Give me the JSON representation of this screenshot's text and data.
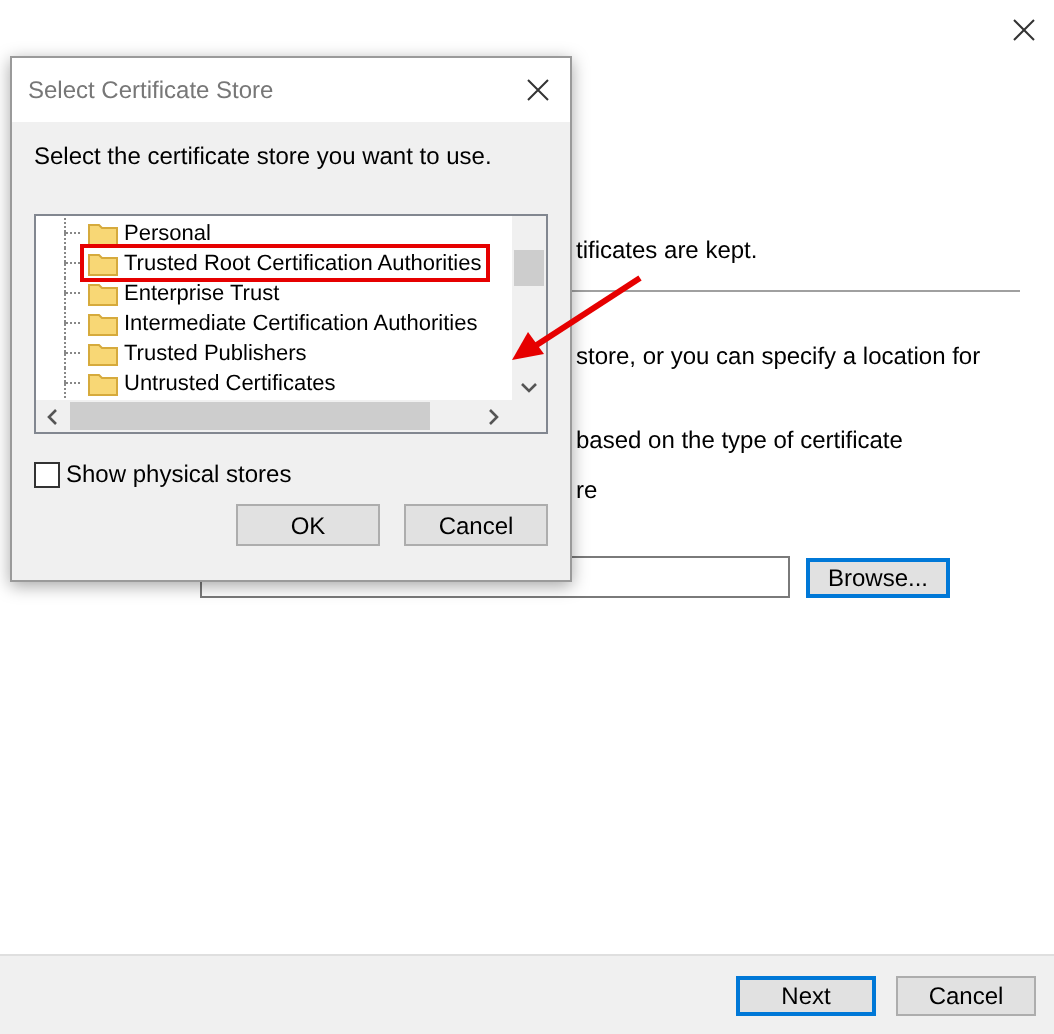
{
  "wizard": {
    "texts": [
      "tificates are kept.",
      "store, or you can specify a location for",
      "based on the type of certificate",
      "re"
    ],
    "browse_button": "Browse...",
    "buttons": [
      {
        "label": "Next",
        "default": true
      },
      {
        "label": "Cancel",
        "default": false
      }
    ]
  },
  "dialog": {
    "title": "Select Certificate Store",
    "prompt": "Select the certificate store you want to use.",
    "stores": [
      {
        "label": "Personal",
        "selected": false
      },
      {
        "label": "Trusted Root Certification Authorities",
        "selected": true
      },
      {
        "label": "Enterprise Trust",
        "selected": false
      },
      {
        "label": "Intermediate Certification Authorities",
        "selected": false
      },
      {
        "label": "Trusted Publishers",
        "selected": false
      },
      {
        "label": "Untrusted Certificates",
        "selected": false
      }
    ],
    "show_physical": {
      "label": "Show physical stores",
      "checked": false
    },
    "buttons": [
      "OK",
      "Cancel"
    ]
  }
}
